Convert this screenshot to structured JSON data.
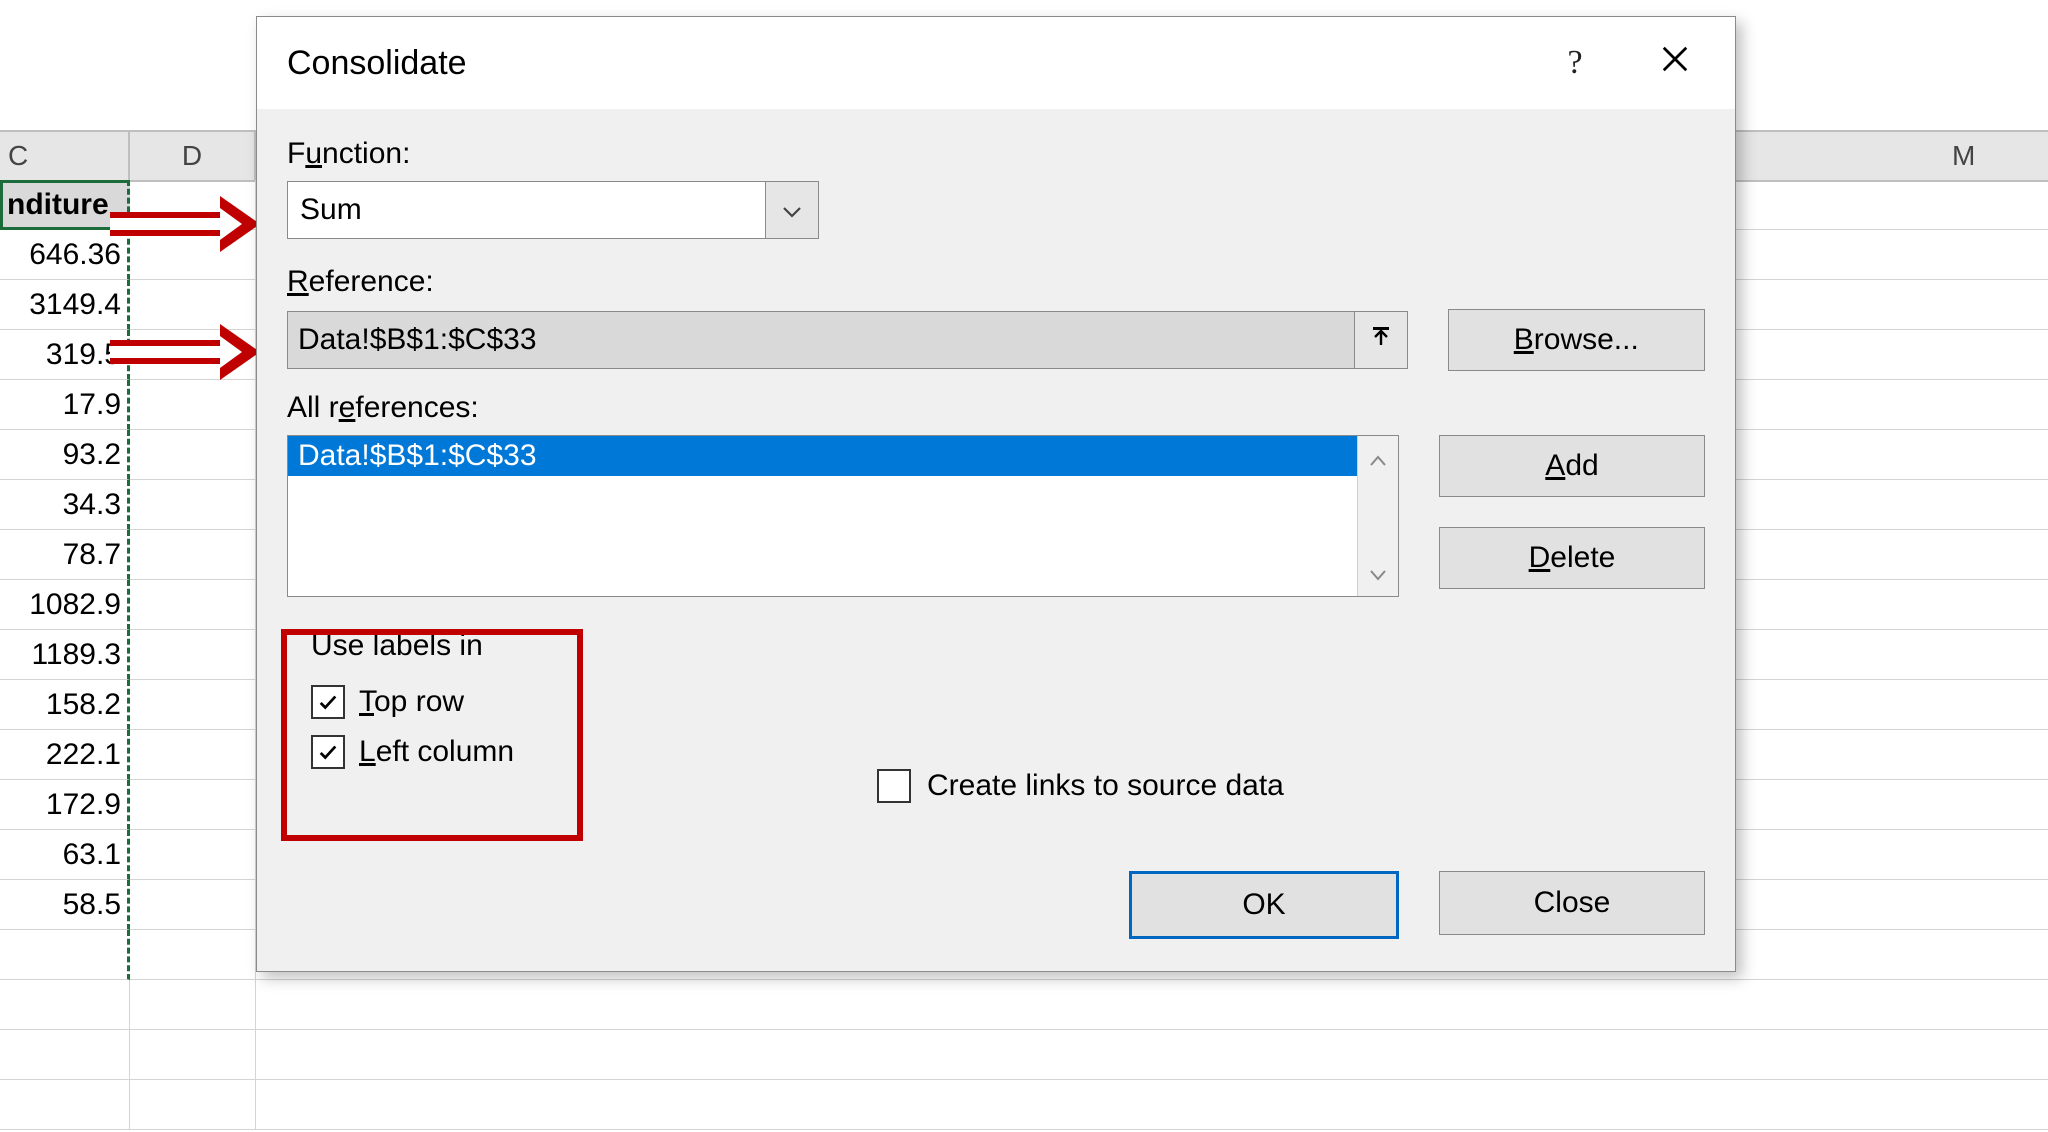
{
  "sheet": {
    "columns": {
      "C": "C",
      "D": "D",
      "M": "M"
    },
    "header_cell": "nditure",
    "values": [
      "646.36",
      "3149.4",
      "319.5",
      "17.9",
      "93.2",
      "34.3",
      "78.7",
      "1082.9",
      "1189.3",
      "158.2",
      "222.1",
      "172.9",
      "63.1",
      "58.5"
    ]
  },
  "dialog": {
    "title": "Consolidate",
    "help_tooltip": "?",
    "function_label_pre": "F",
    "function_label_u": "u",
    "function_label_post": "nction:",
    "function_value": "Sum",
    "reference_label_pre": "",
    "reference_label_u": "R",
    "reference_label_post": "eference:",
    "reference_value": "Data!$B$1:$C$33",
    "browse_pre": "",
    "browse_u": "B",
    "browse_post": "rowse...",
    "allrefs_label_pre": "All r",
    "allrefs_label_u": "e",
    "allrefs_label_post": "ferences:",
    "allrefs_items": [
      "Data!$B$1:$C$33"
    ],
    "add_pre": "",
    "add_u": "A",
    "add_post": "dd",
    "delete_pre": "",
    "delete_u": "D",
    "delete_post": "elete",
    "labels_legend": "Use labels in",
    "top_row_pre": "",
    "top_row_u": "T",
    "top_row_post": "op row",
    "left_col_pre": "",
    "left_col_u": "L",
    "left_col_post": "eft column",
    "links_pre": "Create links to ",
    "links_u": "s",
    "links_post": "ource data",
    "ok": "OK",
    "close": "Close"
  },
  "annotations": {
    "highlight_color": "#C00000"
  }
}
